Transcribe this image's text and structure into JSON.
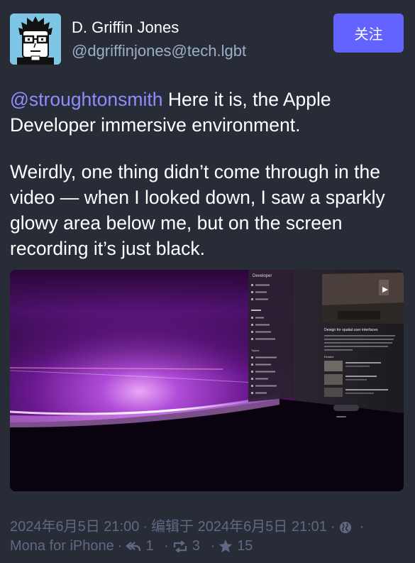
{
  "author": {
    "display_name": "D. Griffin Jones",
    "acct": "@dgriffinjones@tech.lgbt"
  },
  "follow_label": "关注",
  "content": {
    "mention": "@stroughtonsmith",
    "p1_rest": " Here it is, the Apple Developer immersive environment.",
    "p2": "Weirdly, one thing didn’t come through in the video — when I looked down, I saw a sparkly glowy area below me, but on the screen recording it’s just black."
  },
  "media_image": {
    "app_title": "Developer",
    "section_topics": "Topics",
    "article_title": "Design for spatial user interfaces",
    "related_title": "Related"
  },
  "meta": {
    "created": "2024年6月5日 21:00",
    "edited": "编辑于 2024年6月5日 21:01",
    "application": "Mona for iPhone",
    "replies": "1",
    "boosts": "3",
    "favourites": "15",
    "visibility_icon": "globe-icon"
  },
  "colors": {
    "background": "#282c37",
    "accent": "#6364ff",
    "mention": "#8c8dff",
    "secondary_text": "#9baec8",
    "meta_text": "#606984"
  }
}
